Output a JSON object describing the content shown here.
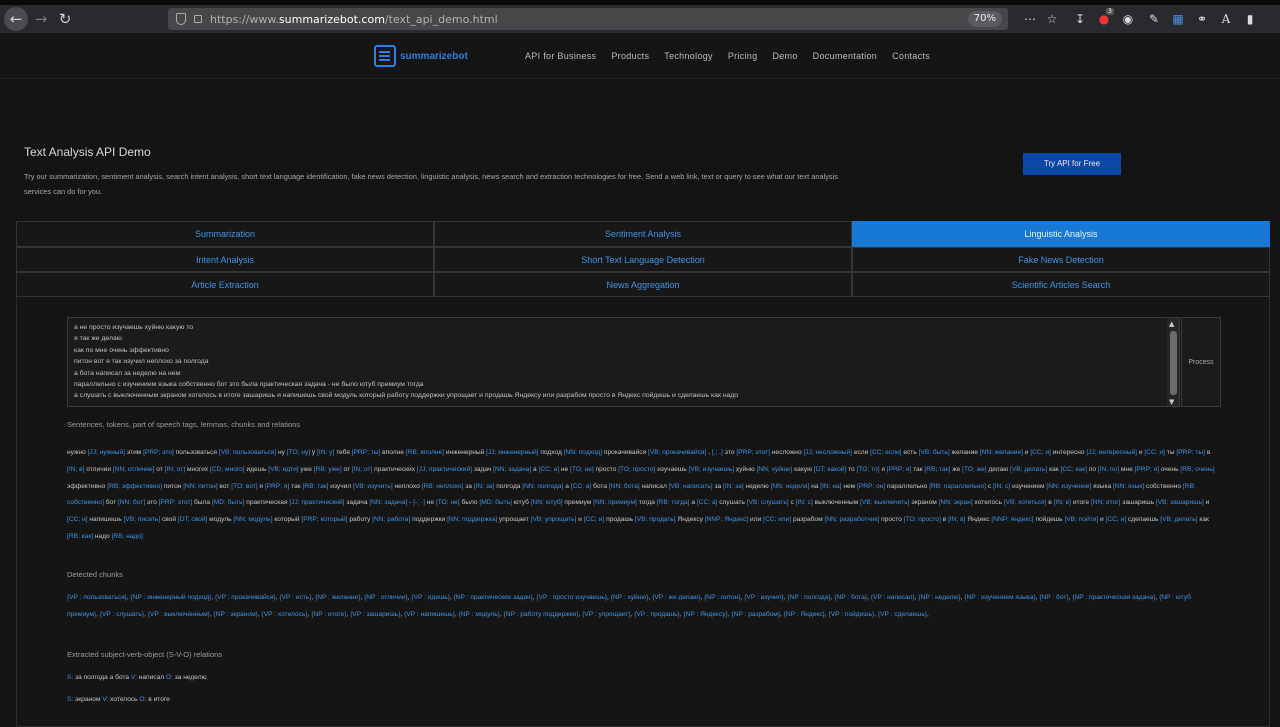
{
  "browser": {
    "url_prefix": "https://www.",
    "url_host": "summarizebot.com",
    "url_path": "/text_api_demo.html",
    "zoom": "70%",
    "badge_count": "3"
  },
  "site": {
    "logo": "summarizebot",
    "nav": [
      "API for Business",
      "Products",
      "Technology",
      "Pricing",
      "Demo",
      "Documentation",
      "Contacts"
    ]
  },
  "hero": {
    "title": "Text Analysis API Demo",
    "description": "Try our summarization, sentiment analysis, search intent analysis, short text language identification, fake news detection, linguistic analysis, news search and extraction technologies for free. Send a web link, text or query to see what our text analysis services can do for you.",
    "cta": "Try API for Free"
  },
  "tabs": [
    {
      "label": "Summarization",
      "active": false
    },
    {
      "label": "Sentiment Analysis",
      "active": false
    },
    {
      "label": "Linguistic Analysis",
      "active": true
    },
    {
      "label": "Intent Analysis",
      "active": false
    },
    {
      "label": "Short Text Language Detection",
      "active": false
    },
    {
      "label": "Fake News Detection",
      "active": false
    },
    {
      "label": "Article Extraction",
      "active": false
    },
    {
      "label": "News Aggregation",
      "active": false
    },
    {
      "label": "Scientific Articles Search",
      "active": false
    }
  ],
  "input": {
    "lines": [
      "а не просто изучаешь хуйню какую то",
      "я так же делаю",
      "как по мне очень эффективно",
      "питон вот я так изучил неплохо за полгода",
      "а бота написал за неделю на нем",
      "параллельно с изучением языка собственно бот это была практическая задача - не было ютуб премиум тогда",
      "а слушать с выключенным экраном хотелось в итоге зашаришь и напишешь свой модуль который работу поддержки упрощает и продашь Яндексу или разрабом просто в Яндекс пойдешь и сделаешь как надо"
    ],
    "process_label": "Process"
  },
  "output": {
    "sentences_heading": "Sentences, tokens, part of speech tags, lemmas, chunks and relations",
    "tokens_text": "нужно [JJ; нужный] этим [PRP; это] пользоваться [VB; пользоваться] ну [TO; ну] у [IN; у] тебя [PRP; ты] вполне [RB; вполне] инженерный [JJ; инженерный] подход [NN; подход] прокачивайся [VB; прокачивайся] , [,; ,] это [PRP; этот] несложно [JJ; несложный] если [CC; если] есть [VB; быть] желание [NN; желание] и [CC; и] интересно [JJ; интересный] и [CC; и] ты [PRP; ты] в [IN; в] отличии [NN; отличие] от [IN; от] многих [CD; много] идешь [VB; идти] уже [RB; уже] от [IN; от] практических [JJ; практический] задач [NN; задача] а [CC; а] не [TO; не] просто [TO; просто] изучаешь [VB; изучаешь] хуйню [NN; хуйню] какую [DT; какой] то [TO; то] я [PRP; я] так [RB; так] же [TO; же] делаю [VB; делать] как [CC; как] по [IN; по] мне [PRP; я] очень [RB; очень] эффективно [RB; эффективно] питон [NN; питон] вот [TO; вот] я [PRP; я] так [RB; так] изучил [VB; изучить] неплохо [RB; неплохо] за [IN; за] полгода [NN; полгода] а [CC; а] бота [NN; бота] написал [VB; написать] за [IN; за] неделю [NN; неделя] на [IN; на] нем [PRP; он] параллельно [RB; параллельно] с [IN; с] изучением [NN; изучение] языка [NN; язык] собственно [RB; собственно] бот [NN; бот] это [PRP; этот] была [MD; быть] практическая [JJ; практический] задача [NN; задача] - [-; -] не [TO; не] было [MD; быть] ютуб [NN; ютуб] премиум [NN; премиум] тогда [RB; тогда] а [CC; а] слушать [VB; слушать] с [IN; с] выключенным [VB; выключить] экраном [NN; экран] хотелось [VB; хотеться] в [IN; в] итоге [NN; итог] зашаришь [VB; зашаришь] и [CC; и] напишешь [VB; писать] свой [DT; свой] модуль [NN; модуль] который [PRP; который] работу [NN; работа] поддержки [NN; поддержка] упрощает [VB; упрощать] и [CC; и] продашь [VB; продать] Яндексу [NNP; Яндекс] или [CC; или] разрабом [NN; разработчик] просто [TO; просто] в [IN; в] Яндекс [NNP; яндекс] пойдешь [VB; пойти] и [CC; и] сделаешь [VB; делать] как [RB; как] надо [RB; надо]",
    "chunks_heading": "Detected chunks",
    "chunks_text": "{VP : пользоваться}, {NP : инженерный подход}, {VP : прокачивайся}, {VP : есть}, {NP : желание}, {NP : отличии}, {VP : идешь}, {NP : практических задач}, {VP : просто изучаешь}, {NP : хуйню}, {VP : же делаю}, {NP : питон}, {VP : изучил}, {NP : полгода}, {NP : бота}, {VP : написал}, {NP : неделю}, {NP : изучением языка}, {NP : бот}, {NP : практическая задача}, {NP : ютуб премиум}, {VP : слушать}, {VP : выключенным}, {NP : экраном}, {VP : хотелось}, {NP : итоге}, {VP : зашаришь}, {VP : напишешь}, {NP : модуль}, {NP : работу поддержки}, {VP : упрощает}, {VP : продашь}, {NP : Яндексу}, {NP : разрабом}, {NP : Яндекс}, {VP : пойдешь}, {VP : сделаешь},",
    "svo_heading": "Extracted subject-verb-object (S-V-O) relations",
    "svo": [
      {
        "s": "за полгода а бота",
        "v": "написал",
        "o": "за неделю"
      },
      {
        "s": "экраном",
        "v": "хотелось",
        "o": "в итоге"
      }
    ]
  }
}
